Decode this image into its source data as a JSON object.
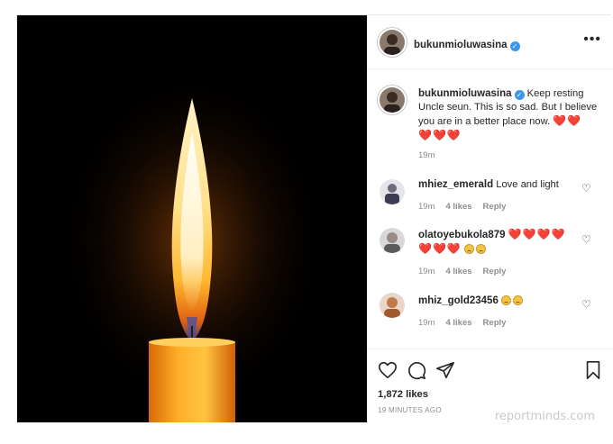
{
  "post": {
    "username": "bukunmioluwasina",
    "verified_icon": "verified-badge-icon",
    "more_icon": "more-options-icon"
  },
  "caption": {
    "username": "bukunmioluwasina",
    "text": "Keep resting Uncle seun. This is so sad. But I believe you are in a better place now.",
    "hearts_line1": "❤️❤️",
    "hearts_line2": "❤️❤️❤️",
    "time": "19m"
  },
  "comments": [
    {
      "username": "mhiez_emerald",
      "text": "Love and light",
      "time": "19m",
      "likes": "4 likes",
      "reply": "Reply"
    },
    {
      "username": "olatoyebukola879",
      "text": "",
      "hearts_line1": "❤️❤️❤️❤️",
      "hearts_line2": "❤️❤️❤️",
      "emoji_count": 2,
      "time": "19m",
      "likes": "4 likes",
      "reply": "Reply"
    },
    {
      "username": "mhiz_gold23456",
      "text": "",
      "emoji_count": 2,
      "time": "19m",
      "likes": "4 likes",
      "reply": "Reply"
    }
  ],
  "actions": {
    "like_icon": "heart-icon",
    "comment_icon": "comment-icon",
    "share_icon": "share-icon",
    "save_icon": "bookmark-icon"
  },
  "likes": "1,872 likes",
  "timestamp": "19 MINUTES AGO",
  "watermark": "reportminds.com",
  "colors": {
    "verified": "#3897f0",
    "heart": "#d0141f",
    "muted": "#8e8e8e",
    "text": "#262626"
  }
}
